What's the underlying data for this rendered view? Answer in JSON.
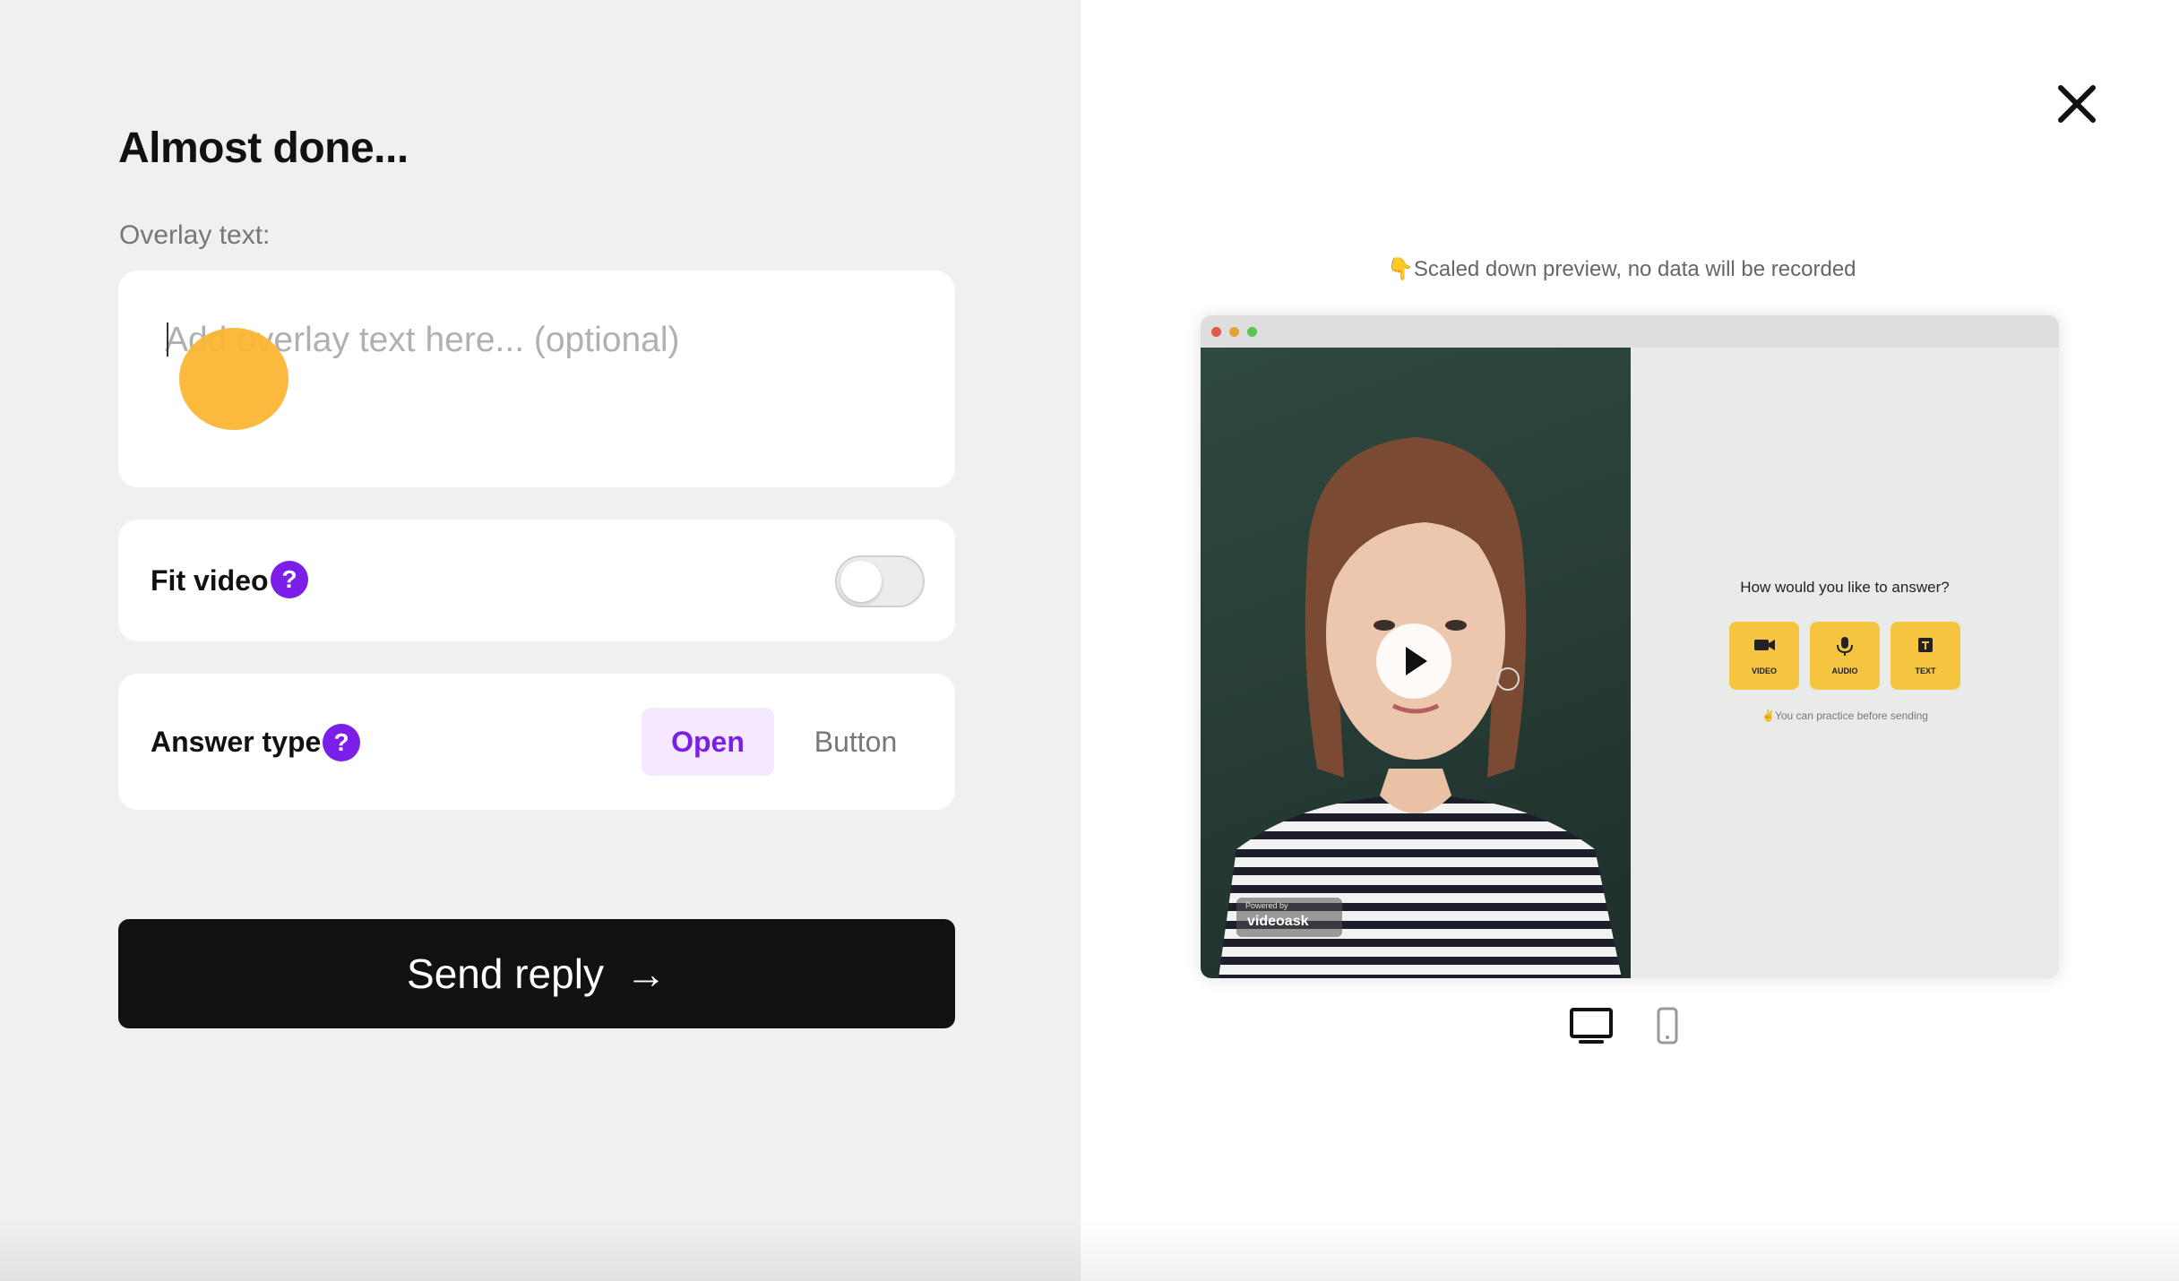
{
  "form": {
    "title": "Almost done...",
    "overlay_label": "Overlay text:",
    "overlay_value": "",
    "overlay_placeholder": "Add overlay text here... (optional)",
    "fit_video_label": "Fit video",
    "fit_video_enabled": false,
    "help_glyph": "?",
    "answer_type_label": "Answer type",
    "answer_type_options": [
      "Open",
      "Button"
    ],
    "answer_type_selected": "Open",
    "send_label": "Send reply",
    "send_arrow": "→"
  },
  "preview": {
    "note": "👇Scaled down preview, no data will be recorded",
    "question": "How would you like to answer?",
    "options": [
      {
        "label": "VIDEO",
        "icon": "video-camera-icon"
      },
      {
        "label": "AUDIO",
        "icon": "microphone-icon"
      },
      {
        "label": "TEXT",
        "icon": "text-icon"
      }
    ],
    "practice_note": "✌️You can practice before sending",
    "powered_by": "Powered by",
    "brand": "videoask",
    "devices": [
      "desktop",
      "mobile"
    ],
    "selected_device": "desktop"
  },
  "colors": {
    "accent_purple": "#7b1fe8",
    "answer_button_yellow": "#f5c542",
    "primary_button": "#111111"
  }
}
